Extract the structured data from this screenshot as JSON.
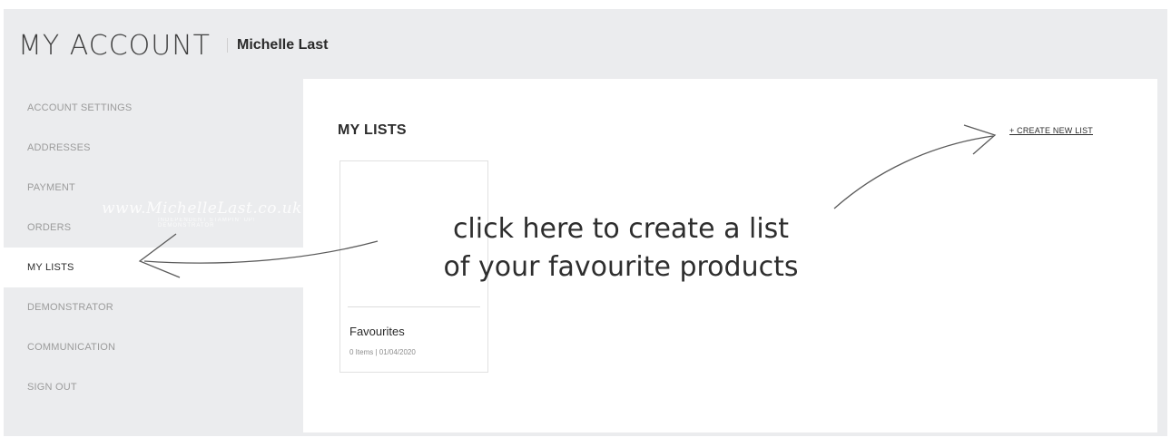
{
  "header": {
    "title": "MY ACCOUNT",
    "username": "Michelle Last"
  },
  "sidebar": {
    "items": [
      {
        "label": "ACCOUNT SETTINGS",
        "active": false
      },
      {
        "label": "ADDRESSES",
        "active": false
      },
      {
        "label": "PAYMENT",
        "active": false
      },
      {
        "label": "ORDERS",
        "active": false
      },
      {
        "label": "MY LISTS",
        "active": true
      },
      {
        "label": "DEMONSTRATOR",
        "active": false
      },
      {
        "label": "COMMUNICATION",
        "active": false
      },
      {
        "label": "SIGN OUT",
        "active": false
      }
    ]
  },
  "watermark": {
    "text": "www.MichelleLast.co.uk",
    "sub": "INDEPENDENT STAMPIN' UP! DEMONSTRATOR"
  },
  "main": {
    "section_title": "MY LISTS",
    "create_link": "+ CREATE NEW LIST",
    "lists": [
      {
        "name": "Favourites",
        "meta": "0 Items | 01/04/2020"
      }
    ]
  },
  "annotation": {
    "line1": "click here to create a list",
    "line2": "of your favourite products"
  },
  "colors": {
    "page_bg": "#ebecee",
    "panel_bg": "#ffffff",
    "nav_inactive": "#9b9b9b",
    "nav_active": "#2b2b2b"
  }
}
